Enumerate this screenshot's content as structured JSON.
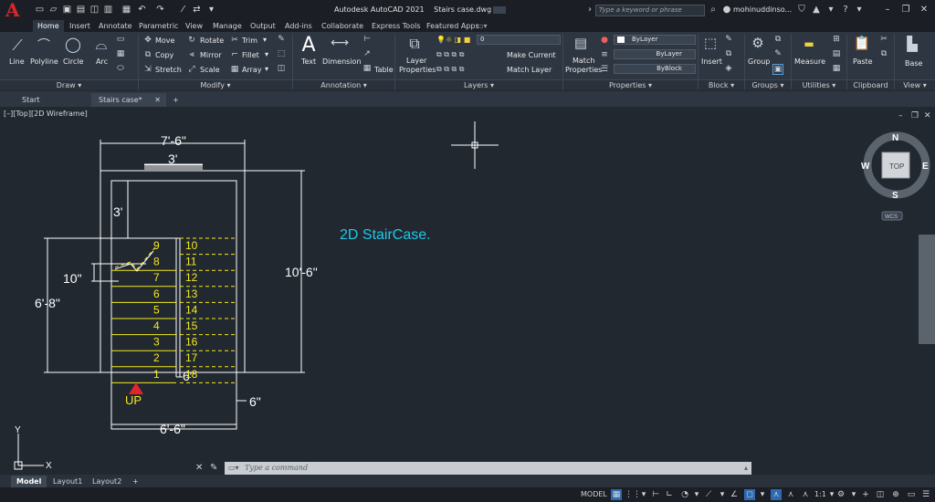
{
  "title_bar": {
    "app_title": "Autodesk AutoCAD 2021",
    "file_name": "Stairs case.dwg",
    "search_placeholder": "Type a keyword or phrase",
    "user_name": "mohinuddinso..."
  },
  "ribbon_tabs": [
    "Home",
    "Insert",
    "Annotate",
    "Parametric",
    "View",
    "Manage",
    "Output",
    "Add-ins",
    "Collaborate",
    "Express Tools",
    "Featured Apps"
  ],
  "ribbon": {
    "draw": {
      "label": "Draw",
      "line": "Line",
      "polyline": "Polyline",
      "circle": "Circle",
      "arc": "Arc"
    },
    "modify": {
      "label": "Modify",
      "move": "Move",
      "rotate": "Rotate",
      "trim": "Trim",
      "copy": "Copy",
      "mirror": "Mirror",
      "fillet": "Fillet",
      "stretch": "Stretch",
      "scale": "Scale",
      "array": "Array"
    },
    "annotation": {
      "label": "Annotation",
      "text": "Text",
      "dimension": "Dimension",
      "table": "Table"
    },
    "layers": {
      "label": "Layers",
      "layer_properties_1": "Layer",
      "layer_properties_2": "Properties",
      "current_layer": "0",
      "make_current": "Make Current",
      "match_layer": "Match Layer"
    },
    "properties": {
      "label": "Properties",
      "match_1": "Match",
      "match_2": "Properties",
      "color": "ByLayer",
      "linetype": "ByLayer",
      "lineweight": "ByBlock"
    },
    "block": {
      "label": "Block",
      "insert": "Insert"
    },
    "groups": {
      "label": "Groups",
      "group": "Group"
    },
    "utilities": {
      "label": "Utilities",
      "measure": "Measure"
    },
    "clipboard": {
      "label": "Clipboard",
      "paste": "Paste"
    },
    "view": {
      "label": "View",
      "base": "Base"
    }
  },
  "doc_tabs": {
    "start": "Start",
    "active": "Stairs case*"
  },
  "viewport": {
    "label": "[–][Top][2D Wireframe]",
    "viewcube": {
      "n": "N",
      "s": "S",
      "e": "E",
      "w": "W",
      "top": "TOP",
      "wcs": "WCS"
    },
    "ucs": {
      "x": "X",
      "y": "Y"
    }
  },
  "drawing": {
    "title": "2D StairCase.",
    "dim_top_width": "7'-6\"",
    "dim_landing_width": "3'",
    "dim_landing_depth": "3'",
    "dim_right_height": "10'-6\"",
    "dim_left_height": "6'-8\"",
    "dim_tread": "10\"",
    "dim_gap": "6\"",
    "dim_wall": "6\"",
    "dim_bottom_width": "6'-6\"",
    "up_label": "UP",
    "steps_left": [
      "9",
      "8",
      "7",
      "6",
      "5",
      "4",
      "3",
      "2",
      "1"
    ],
    "steps_right": [
      "10",
      "11",
      "12",
      "13",
      "14",
      "15",
      "16",
      "17",
      "18"
    ]
  },
  "command_line": {
    "placeholder": "Type a command"
  },
  "layout_tabs": [
    "Model",
    "Layout1",
    "Layout2"
  ],
  "status_bar": {
    "model": "MODEL",
    "scale": "1:1"
  },
  "colors": {
    "step_numbers": "#f4ea1e",
    "title_text": "#1ec8e8",
    "dimension": "#ffffff",
    "up_arrow": "#e0262c"
  }
}
